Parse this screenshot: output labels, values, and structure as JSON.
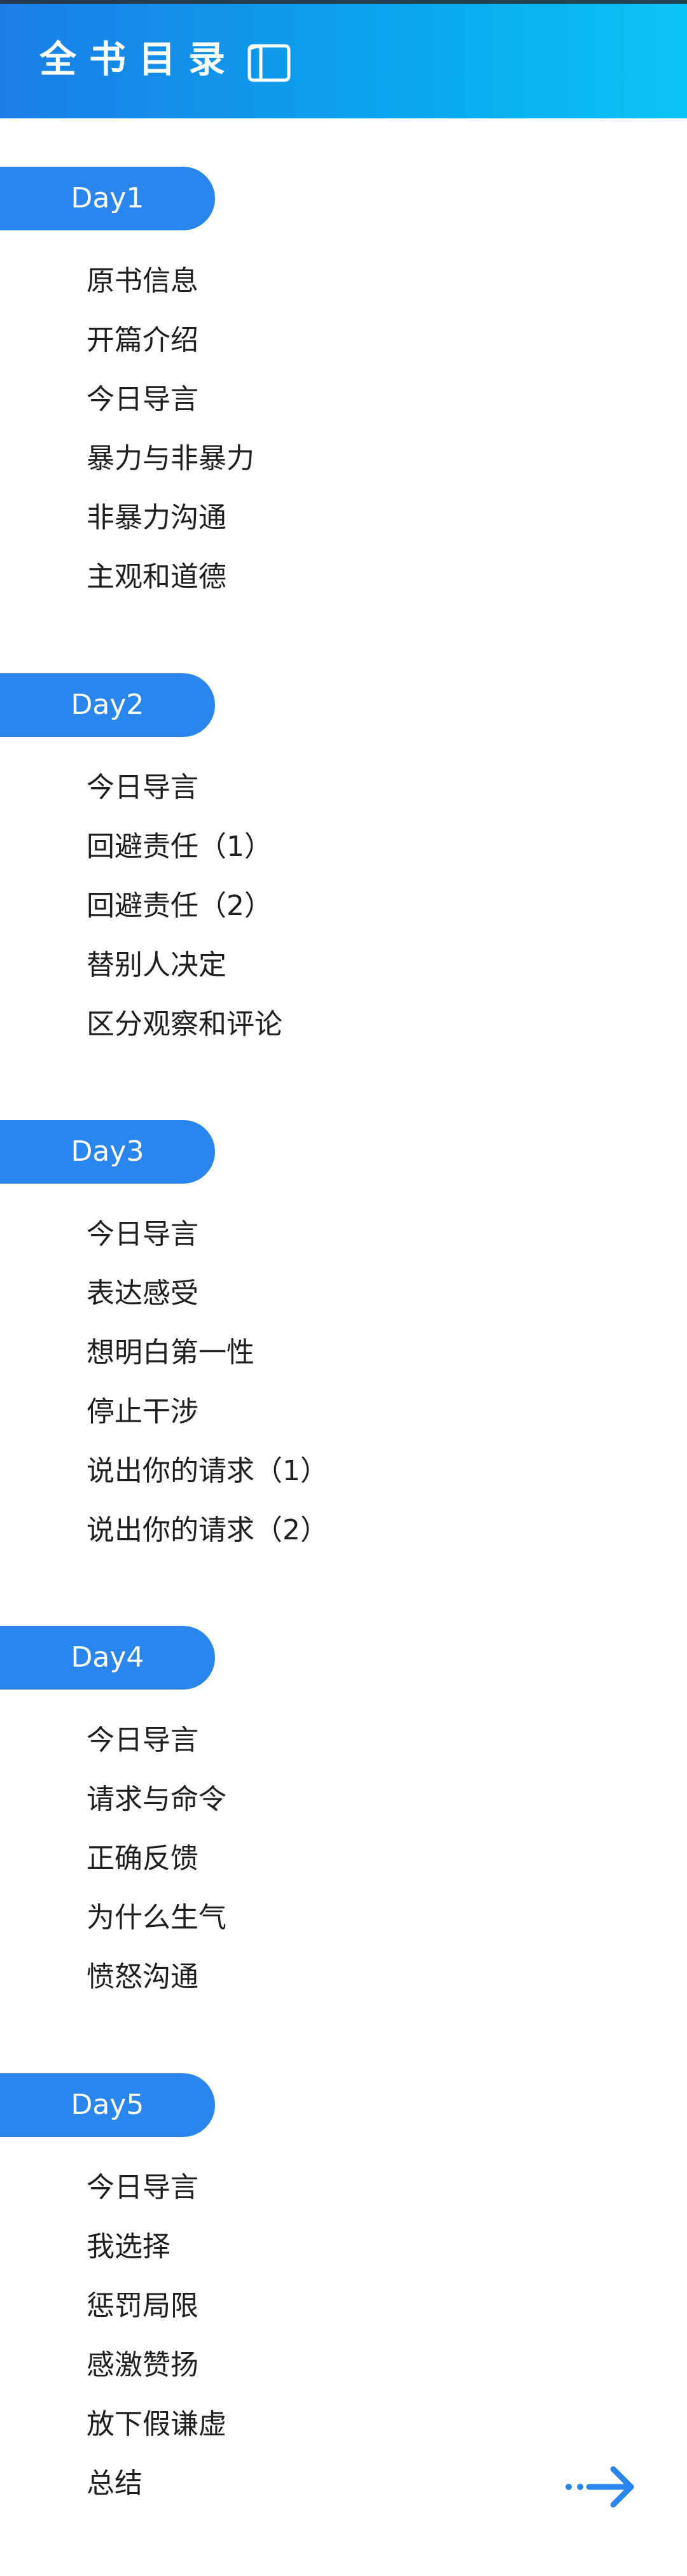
{
  "header": {
    "title": "全书目录",
    "book_icon": "book-open-icon"
  },
  "days": [
    {
      "label": "Day1",
      "lessons": [
        "原书信息",
        "开篇介绍",
        "今日导言",
        "暴力与非暴力",
        "非暴力沟通",
        "主观和道德"
      ]
    },
    {
      "label": "Day2",
      "lessons": [
        "今日导言",
        "回避责任（1）",
        "回避责任（2）",
        "替别人决定",
        "区分观察和评论"
      ]
    },
    {
      "label": "Day3",
      "lessons": [
        "今日导言",
        "表达感受",
        "想明白第一性",
        "停止干涉",
        "说出你的请求（1）",
        "说出你的请求（2）"
      ]
    },
    {
      "label": "Day4",
      "lessons": [
        "今日导言",
        "请求与命令",
        "正确反馈",
        "为什么生气",
        "愤怒沟通"
      ]
    },
    {
      "label": "Day5",
      "lessons": [
        "今日导言",
        "我选择",
        "惩罚局限",
        "感激赞扬",
        "放下假谦虚",
        "总结"
      ]
    }
  ],
  "colors": {
    "header_gradient_start": "#1b7ee6",
    "header_gradient_end": "#0cc4f6",
    "day_pill": "#2a86ec",
    "lesson_text": "#1f1f1f",
    "arrow": "#2a86ec"
  },
  "footer": {
    "next_icon": "arrow-right-icon"
  }
}
